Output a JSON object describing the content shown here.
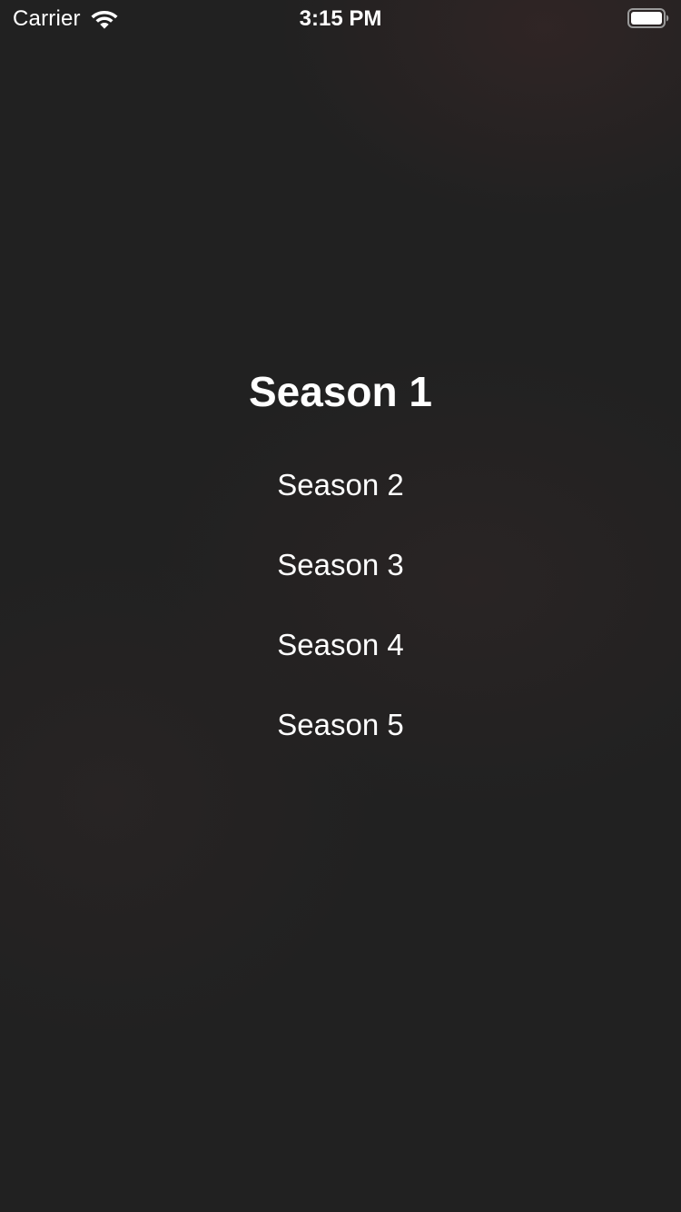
{
  "status_bar": {
    "carrier": "Carrier",
    "time": "3:15 PM",
    "icons": [
      "wifi-icon",
      "battery-icon"
    ]
  },
  "seasons": {
    "selected_index": 0,
    "items": [
      {
        "label": "Season 1"
      },
      {
        "label": "Season 2"
      },
      {
        "label": "Season 3"
      },
      {
        "label": "Season 4"
      },
      {
        "label": "Season 5"
      }
    ]
  },
  "colors": {
    "background": "#212121",
    "text": "#ffffff"
  }
}
